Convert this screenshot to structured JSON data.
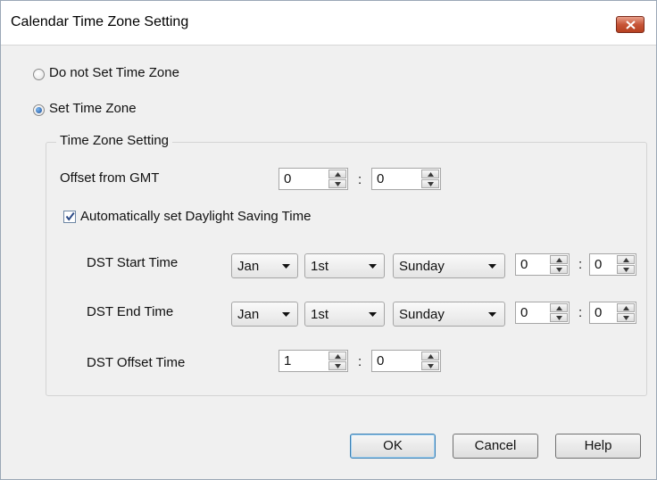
{
  "window": {
    "title": "Calendar Time Zone Setting"
  },
  "options": {
    "do_not_set": "Do not Set Time Zone",
    "set": "Set Time Zone",
    "selected": "set"
  },
  "group": {
    "title": "Time Zone Setting",
    "offset_label": "Offset from GMT",
    "offset_hours": "0",
    "offset_minutes": "0",
    "colon": ":",
    "auto_dst_label": "Automatically set  Daylight Saving Time",
    "auto_dst_checked": true,
    "dst_start": {
      "label": "DST Start Time",
      "month": "Jan",
      "week": "1st",
      "day": "Sunday",
      "hours": "0",
      "minutes": "0"
    },
    "dst_end": {
      "label": "DST End Time",
      "month": "Jan",
      "week": "1st",
      "day": "Sunday",
      "hours": "0",
      "minutes": "0"
    },
    "dst_offset": {
      "label": "DST Offset Time",
      "hours": "1",
      "minutes": "0"
    }
  },
  "buttons": {
    "ok": "OK",
    "cancel": "Cancel",
    "help": "Help"
  },
  "icons": {
    "close": "close-icon",
    "spin_up": "arrow-up-icon",
    "spin_down": "arrow-down-icon",
    "dropdown": "chevron-down-icon",
    "check": "check-icon"
  }
}
